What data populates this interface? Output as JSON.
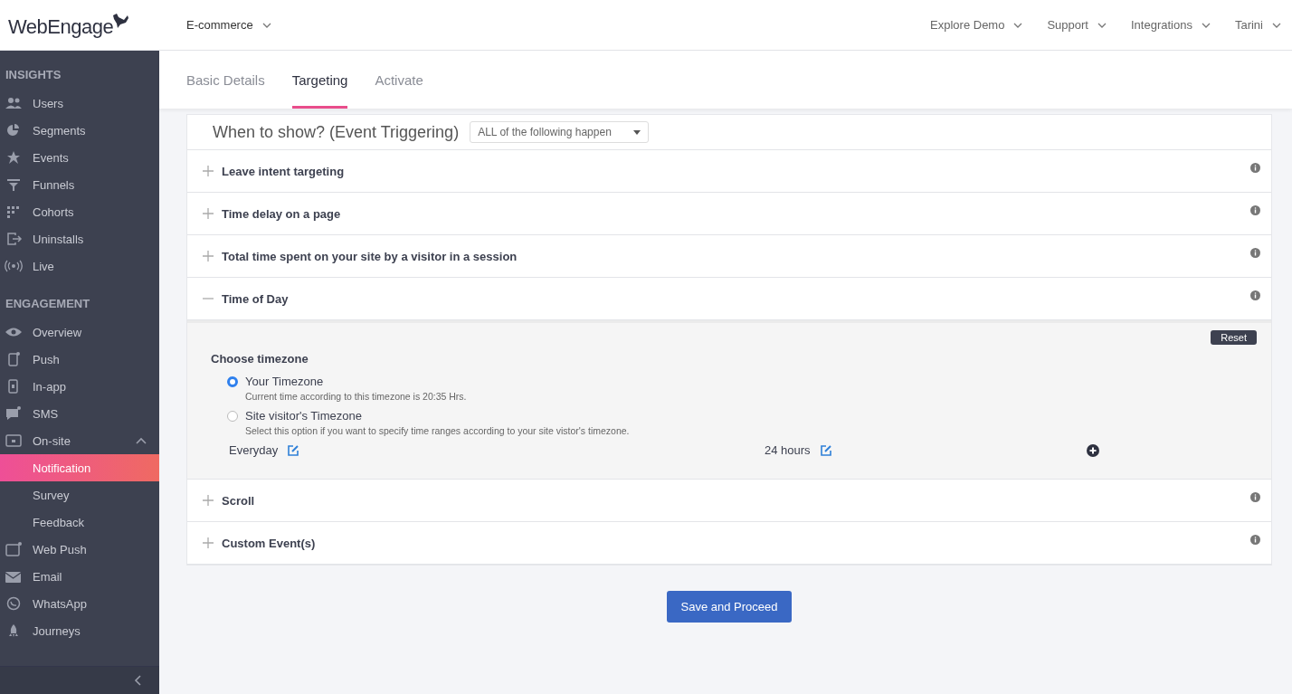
{
  "brand": {
    "name": "WebEngage"
  },
  "project": {
    "label": "E-commerce"
  },
  "top_nav": [
    {
      "label": "Explore Demo"
    },
    {
      "label": "Support"
    },
    {
      "label": "Integrations"
    },
    {
      "label": "Tarini"
    }
  ],
  "sidebar": {
    "sections": [
      {
        "title": "INSIGHTS",
        "items": [
          {
            "label": "Users",
            "kind": "users",
            "selected": false
          },
          {
            "label": "Segments",
            "kind": "pie",
            "selected": false
          },
          {
            "label": "Events",
            "kind": "star",
            "selected": false
          },
          {
            "label": "Funnels",
            "kind": "funnel",
            "selected": false
          },
          {
            "label": "Cohorts",
            "kind": "grid",
            "selected": false
          },
          {
            "label": "Uninstalls",
            "kind": "exit",
            "selected": false
          },
          {
            "label": "Live",
            "kind": "live",
            "selected": false
          }
        ]
      },
      {
        "title": "ENGAGEMENT",
        "items": [
          {
            "label": "Overview",
            "kind": "eye",
            "selected": false
          },
          {
            "label": "Push",
            "kind": "phone",
            "selected": false
          },
          {
            "label": "In-app",
            "kind": "inapp",
            "selected": false
          },
          {
            "label": "SMS",
            "kind": "chat",
            "selected": false
          },
          {
            "label": "On-site",
            "kind": "window",
            "selected": false,
            "expanded": true,
            "children": [
              {
                "label": "Notification",
                "selected": true
              },
              {
                "label": "Survey",
                "selected": false
              },
              {
                "label": "Feedback",
                "selected": false
              }
            ]
          },
          {
            "label": "Web Push",
            "kind": "browser",
            "selected": false
          },
          {
            "label": "Email",
            "kind": "mail",
            "selected": false
          },
          {
            "label": "WhatsApp",
            "kind": "whatsapp",
            "selected": false
          },
          {
            "label": "Journeys",
            "kind": "rocket",
            "selected": false
          }
        ]
      }
    ]
  },
  "tabs": [
    {
      "label": "Basic Details",
      "selected": false
    },
    {
      "label": "Targeting",
      "selected": true
    },
    {
      "label": "Activate",
      "selected": false
    }
  ],
  "trigger": {
    "title": "When to show? (Event Triggering)",
    "select_value": "ALL of the following happen"
  },
  "rules": [
    {
      "label": "Leave intent targeting",
      "expanded": false
    },
    {
      "label": "Time delay on a page",
      "expanded": false
    },
    {
      "label": "Total time spent on your site by a visitor in a session",
      "expanded": false
    },
    {
      "label": "Time of Day",
      "expanded": true,
      "detail": {
        "reset": "Reset",
        "heading": "Choose timezone",
        "options": [
          {
            "label": "Your Timezone",
            "hint": "Current time according to this timezone is 20:35 Hrs.",
            "selected": true
          },
          {
            "label": "Site visitor's Timezone",
            "hint": "Select this option if you want to specify time ranges according to your site vistor's timezone.",
            "selected": false
          }
        ],
        "days": "Everyday",
        "hours": "24 hours"
      }
    },
    {
      "label": "Scroll",
      "expanded": false
    },
    {
      "label": "Custom Event(s)",
      "expanded": false
    }
  ],
  "primary_button": "Save and Proceed"
}
